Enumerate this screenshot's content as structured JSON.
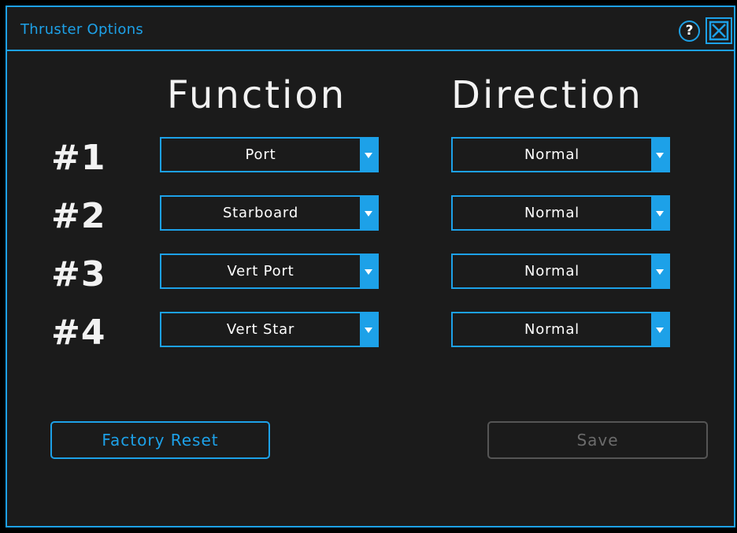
{
  "window": {
    "title": "Thruster Options",
    "help_label": "?",
    "close_icon": "close-box-icon"
  },
  "headers": {
    "function": "Function",
    "direction": "Direction"
  },
  "rows": [
    {
      "label": "#1",
      "function": "Port",
      "direction": "Normal"
    },
    {
      "label": "#2",
      "function": "Starboard",
      "direction": "Normal"
    },
    {
      "label": "#3",
      "function": "Vert Port",
      "direction": "Normal"
    },
    {
      "label": "#4",
      "function": "Vert Star",
      "direction": "Normal"
    }
  ],
  "buttons": {
    "factory_reset": "Factory Reset",
    "save": "Save",
    "save_enabled": false
  },
  "colors": {
    "accent": "#1da1e8",
    "background": "#1b1b1b",
    "disabled": "#6b6b6b"
  }
}
